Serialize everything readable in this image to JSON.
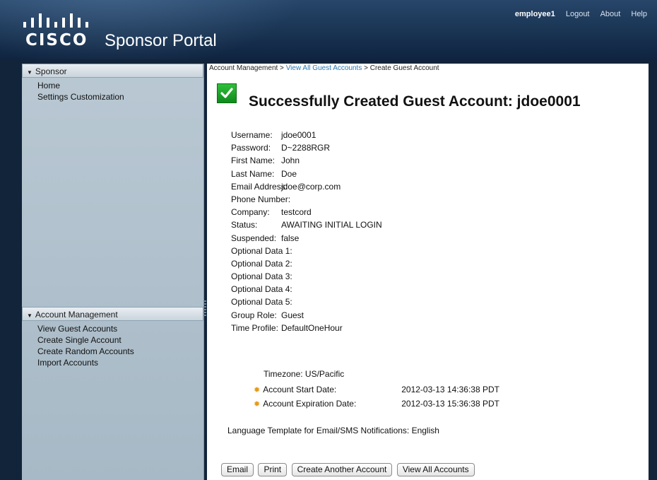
{
  "header": {
    "logo_text": "CISCO",
    "title": "Sponsor Portal",
    "user": "employee1",
    "links": [
      "Logout",
      "About",
      "Help"
    ]
  },
  "sidebar": {
    "sponsor": {
      "heading": "Sponsor",
      "items": [
        "Home",
        "Settings Customization"
      ]
    },
    "account_management": {
      "heading": "Account Management",
      "items": [
        "View Guest Accounts",
        "Create Single Account",
        "Create Random Accounts",
        "Import Accounts"
      ]
    }
  },
  "breadcrumb": {
    "part1": "Account Management >",
    "link": "View All Guest Accounts",
    "part3": "> Create Guest Account"
  },
  "main": {
    "title": "Successfully Created Guest Account:  jdoe0001",
    "fields": [
      {
        "label": "Username:",
        "value": "jdoe0001"
      },
      {
        "label": "Password:",
        "value": "D~2288RGR"
      },
      {
        "label": "First Name:",
        "value": "John"
      },
      {
        "label": "Last Name:",
        "value": "Doe"
      },
      {
        "label": "Email Address:",
        "value": "jdoe@corp.com"
      },
      {
        "label": "Phone Number:",
        "value": ""
      },
      {
        "label": "Company:",
        "value": "testcord"
      },
      {
        "label": "Status:",
        "value": "AWAITING INITIAL LOGIN"
      },
      {
        "label": "Suspended:",
        "value": "false"
      },
      {
        "label": "Optional Data 1:",
        "value": ""
      },
      {
        "label": "Optional Data 2:",
        "value": ""
      },
      {
        "label": "Optional Data 3:",
        "value": ""
      },
      {
        "label": "Optional Data 4:",
        "value": ""
      },
      {
        "label": "Optional Data 5:",
        "value": ""
      },
      {
        "label": "Group Role:",
        "value": "Guest"
      },
      {
        "label": "Time Profile:",
        "value": "DefaultOneHour"
      }
    ],
    "timezone": "Timezone: US/Pacific",
    "start_label": "Account Start Date:",
    "start_value": "2012-03-13 14:36:38 PDT",
    "expiration_label": "Account Expiration Date:",
    "expiration_value": "2012-03-13 15:36:38 PDT",
    "language": "Language Template for Email/SMS Notifications: English",
    "buttons": [
      "Email",
      "Print",
      "Create Another Account",
      "View All Accounts"
    ]
  },
  "colors": {
    "header_bg": "#193352",
    "sidebar_bg": "#b1c2ce",
    "link": "#2a7ab8",
    "success_green": "#1aa52a",
    "gear_orange": "#e59a1a"
  }
}
